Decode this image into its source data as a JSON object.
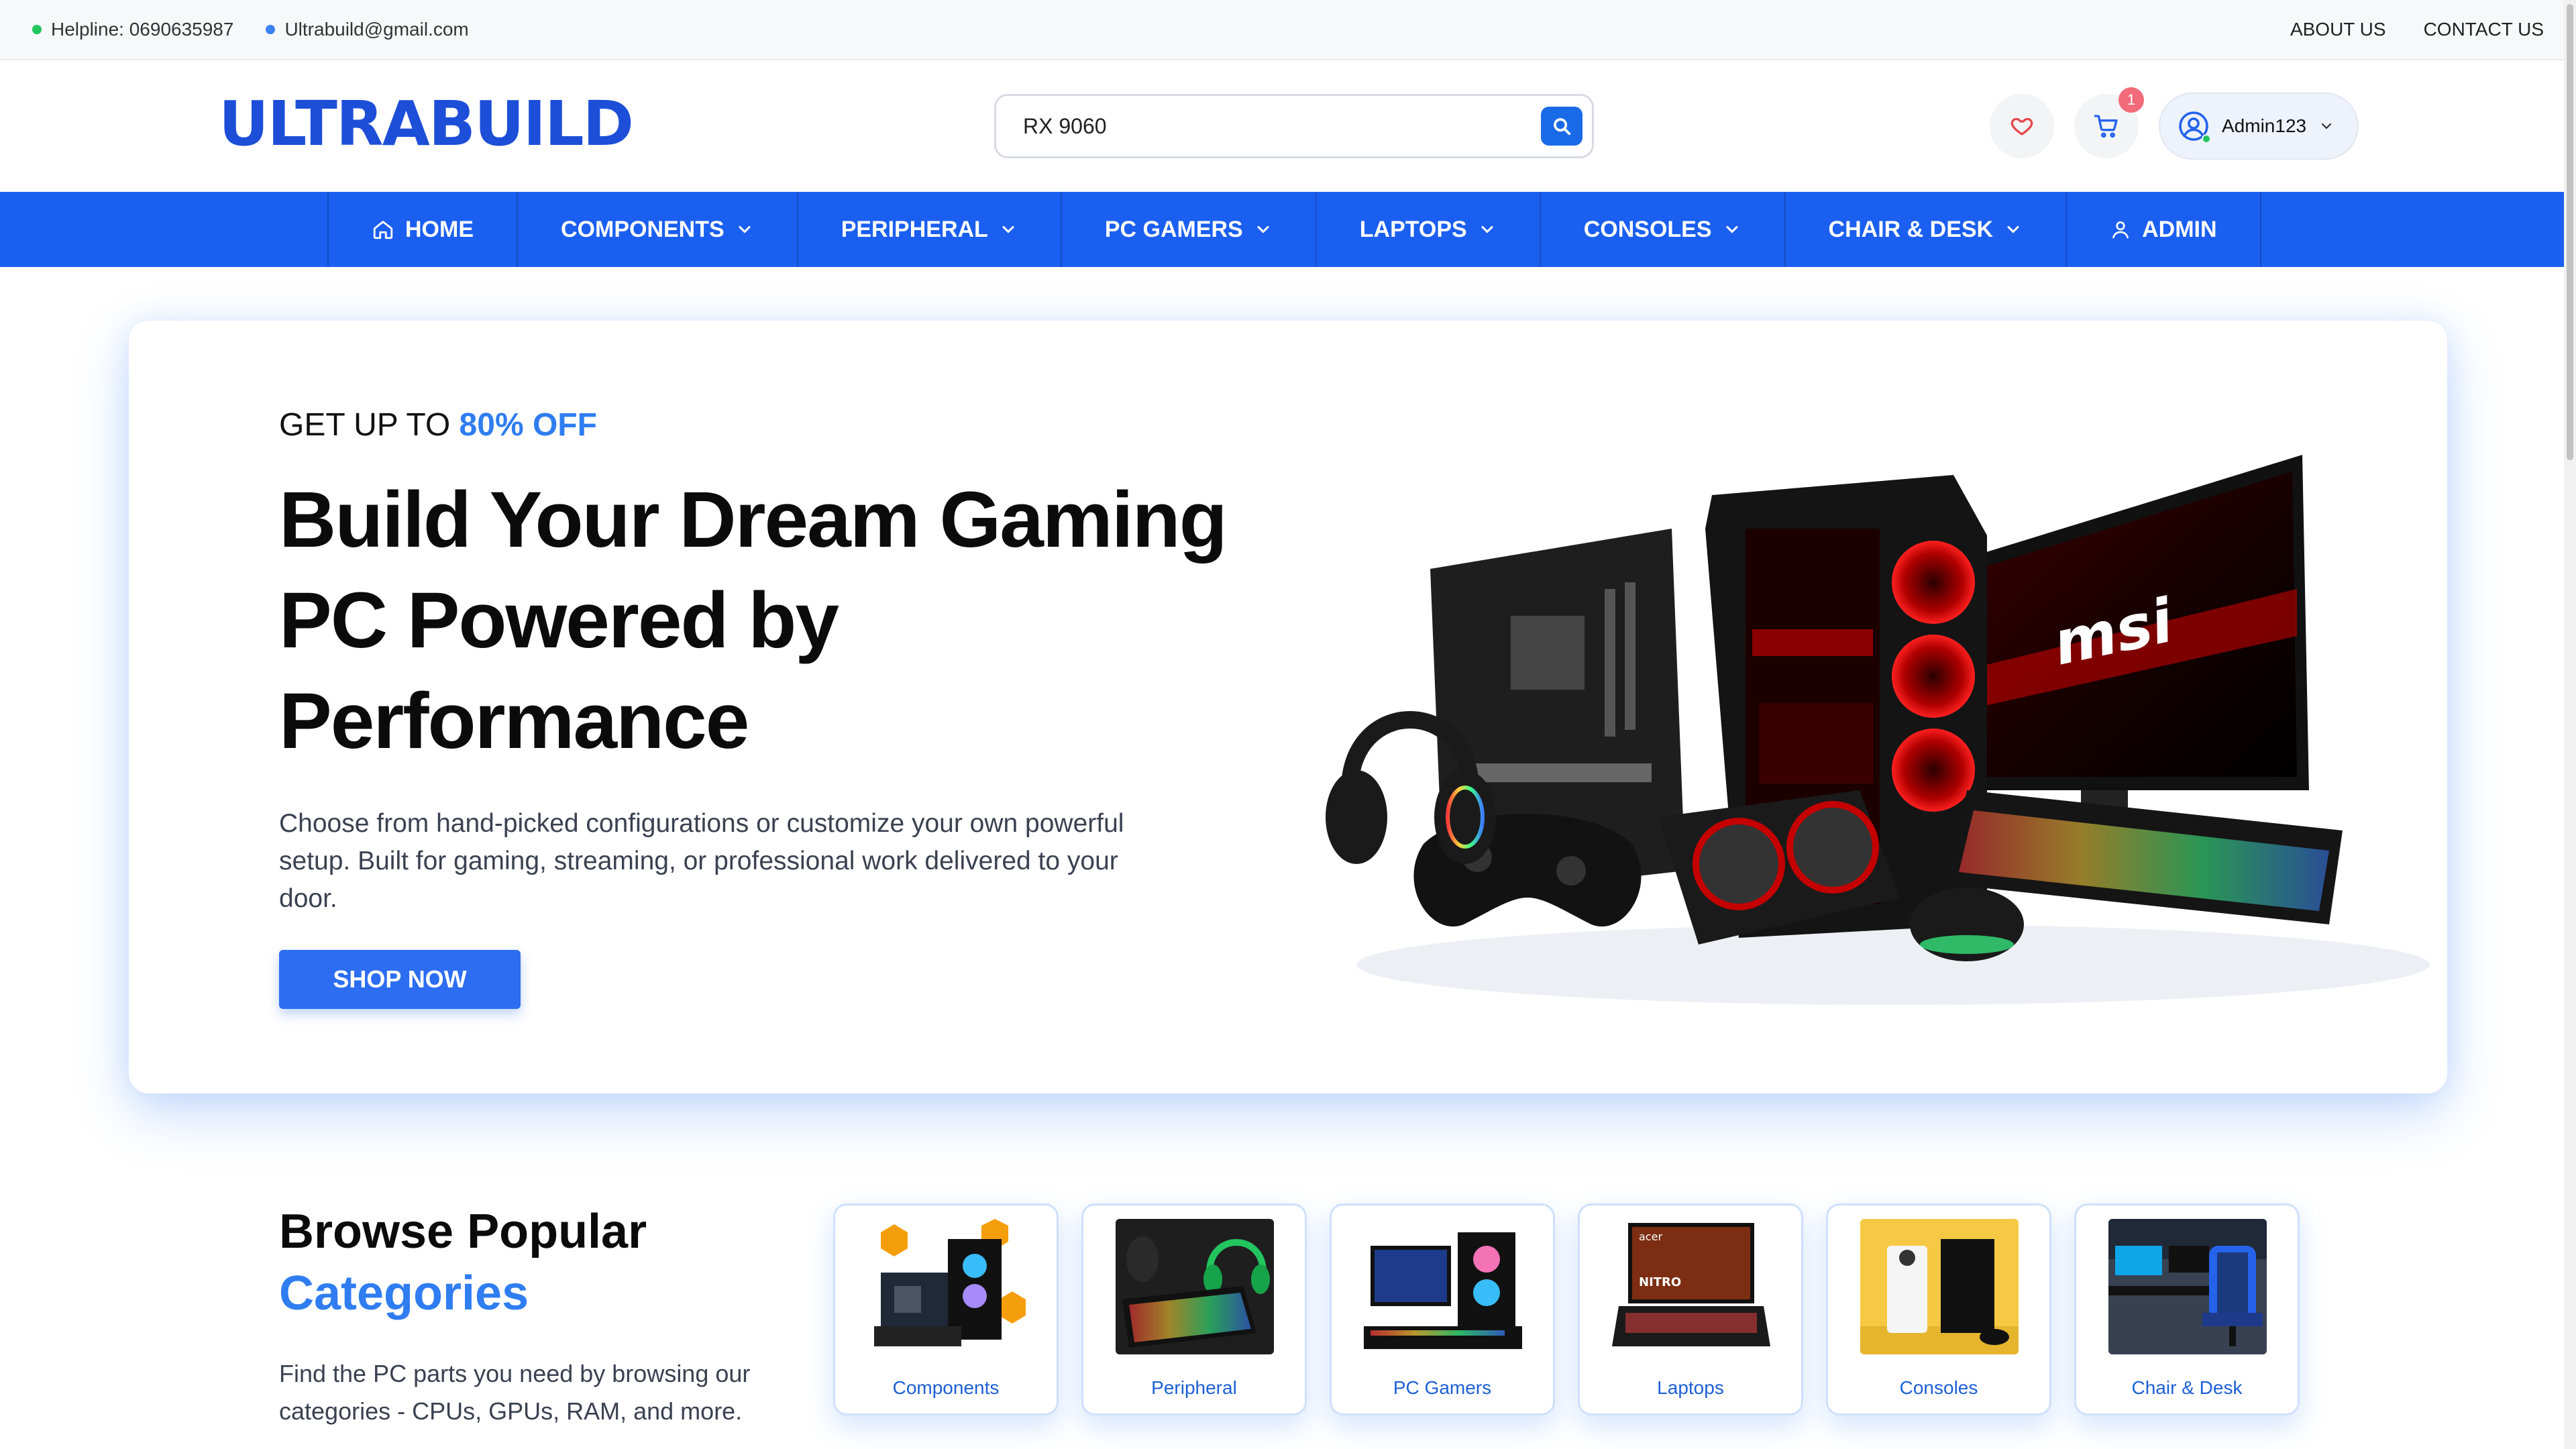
{
  "utility": {
    "helpline": "Helpline: 0690635987",
    "email": "Ultrabuild@gmail.com",
    "links": [
      "ABOUT US",
      "CONTACT US"
    ]
  },
  "header": {
    "logo": "ULTRABUILD",
    "search_value": "RX 9060",
    "cart_count": "1",
    "account_name": "Admin123"
  },
  "nav": {
    "items": [
      "HOME",
      "COMPONENTS",
      "PERIPHERAL",
      "PC GAMERS",
      "LAPTOPS",
      "CONSOLES",
      "CHAIR & DESK",
      "ADMIN"
    ]
  },
  "hero": {
    "eyebrow_prefix": "GET UP TO ",
    "eyebrow_accent": "80% OFF",
    "title": "Build Your Dream Gaming PC Powered by Performance",
    "description": "Choose from hand-picked configurations or customize your own powerful setup. Built for gaming, streaming, or professional work delivered to your door.",
    "button": "SHOP NOW",
    "brand_mark": "msi"
  },
  "categories": {
    "heading_line1": "Browse Popular",
    "heading_line2": "Categories",
    "description": "Find the PC parts you need by browsing our categories - CPUs, GPUs, RAM, and more.",
    "items": [
      {
        "label": "Components"
      },
      {
        "label": "Peripheral"
      },
      {
        "label": "PC Gamers"
      },
      {
        "label": "Laptops"
      },
      {
        "label": "Consoles"
      },
      {
        "label": "Chair & Desk"
      }
    ],
    "thumb_texts": {
      "laptop_brand": "acer",
      "laptop_model": "NITRO"
    }
  },
  "colors": {
    "brand": "#1d4ed8",
    "nav_bg": "#1a5ff0",
    "accent": "#2f7df0",
    "badge": "#f26b7a",
    "online": "#22c55e"
  }
}
